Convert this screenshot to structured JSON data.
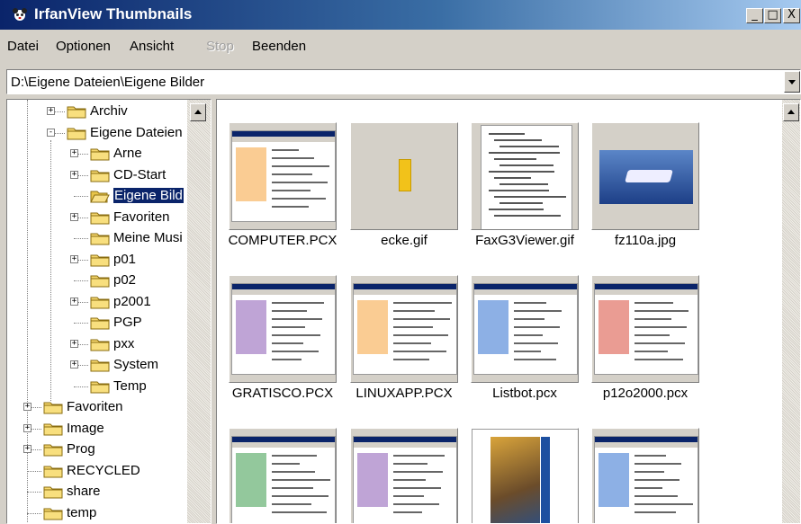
{
  "window": {
    "title": "IrfanView Thumbnails",
    "min_label": "_",
    "max_label": "□",
    "close_label": "X"
  },
  "menu": [
    {
      "label": "Datei",
      "disabled": false
    },
    {
      "label": "Optionen",
      "disabled": false
    },
    {
      "label": "Ansicht",
      "disabled": false
    },
    {
      "label": "Stop",
      "disabled": true
    },
    {
      "label": "Beenden",
      "disabled": false
    }
  ],
  "path": {
    "value": "D:\\Eigene Dateien\\Eigene Bilder"
  },
  "tree": [
    {
      "label": "Archiv",
      "expander": "+"
    },
    {
      "label": "Eigene Dateien",
      "expander": "−"
    },
    {
      "label": "Arne",
      "expander": "+"
    },
    {
      "label": "CD-Start",
      "expander": "+"
    },
    {
      "label": "Eigene Bild",
      "expander": "",
      "selected": true
    },
    {
      "label": "Favoriten",
      "expander": "+"
    },
    {
      "label": "Meine Musi",
      "expander": ""
    },
    {
      "label": "p01",
      "expander": "+"
    },
    {
      "label": "p02",
      "expander": ""
    },
    {
      "label": "p2001",
      "expander": "+"
    },
    {
      "label": "PGP",
      "expander": ""
    },
    {
      "label": "pxx",
      "expander": "+"
    },
    {
      "label": "System",
      "expander": "+"
    },
    {
      "label": "Temp",
      "expander": ""
    },
    {
      "label": "Favoriten",
      "expander": "+"
    },
    {
      "label": "Image",
      "expander": "+"
    },
    {
      "label": "Prog",
      "expander": "+"
    },
    {
      "label": "RECYCLED",
      "expander": ""
    },
    {
      "label": "share",
      "expander": ""
    },
    {
      "label": "temp",
      "expander": ""
    }
  ],
  "thumbnails": [
    {
      "filename": "COMPUTER.PCX",
      "kind": "screenshot"
    },
    {
      "filename": "ecke.gif",
      "kind": "small-image"
    },
    {
      "filename": "FaxG3Viewer.gif",
      "kind": "document"
    },
    {
      "filename": "fz110a.jpg",
      "kind": "photo"
    },
    {
      "filename": "GRATISCO.PCX",
      "kind": "screenshot"
    },
    {
      "filename": "LINUXAPP.PCX",
      "kind": "screenshot"
    },
    {
      "filename": "Listbot.pcx",
      "kind": "screenshot"
    },
    {
      "filename": "p12o2000.pcx",
      "kind": "screenshot"
    },
    {
      "filename": "",
      "kind": "screenshot"
    },
    {
      "filename": "",
      "kind": "screenshot"
    },
    {
      "filename": "",
      "kind": "book-cover"
    },
    {
      "filename": "",
      "kind": "screenshot"
    }
  ],
  "colors": {
    "selection": "#0a246a",
    "folder": "#f5d76e",
    "titlebar_start": "#0a246a"
  }
}
